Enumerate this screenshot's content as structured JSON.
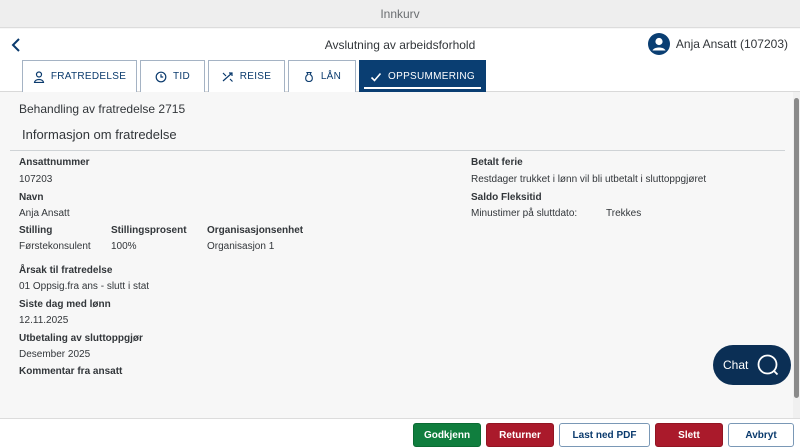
{
  "window": {
    "title": "Innkurv"
  },
  "header": {
    "title": "Avslutning av arbeidsforhold",
    "user": "Anja Ansatt (107203)"
  },
  "tabs": [
    {
      "label": "FRATREDELSE",
      "icon": "person-icon"
    },
    {
      "label": "TID",
      "icon": "clock-icon"
    },
    {
      "label": "REISE",
      "icon": "travel-icon"
    },
    {
      "label": "LÅN",
      "icon": "money-bag-icon"
    },
    {
      "label": "OPPSUMMERING",
      "icon": "check-icon",
      "active": true
    }
  ],
  "main": {
    "behandling": "Behandling av fratredelse 2715",
    "section_title": "Informasjon om fratredelse",
    "fields": {
      "ansattnummer_label": "Ansattnummer",
      "ansattnummer_value": "107203",
      "navn_label": "Navn",
      "navn_value": "Anja Ansatt",
      "stilling_label": "Stilling",
      "stilling_value": "Førstekonsulent",
      "stillingsprosent_label": "Stillingsprosent",
      "stillingsprosent_value": "100%",
      "orgenhet_label": "Organisasjonsenhet",
      "orgenhet_value": "Organisasjon 1",
      "arsak_label": "Årsak til fratredelse",
      "arsak_value": "01 Oppsig.fra ans - slutt i stat",
      "siste_dag_label": "Siste dag med lønn",
      "siste_dag_value": "12.11.2025",
      "utbetaling_label": "Utbetaling av sluttoppgjør",
      "utbetaling_value": "Desember 2025",
      "kommentar_label": "Kommentar fra ansatt",
      "betalt_ferie_label": "Betalt ferie",
      "betalt_ferie_value": "Restdager trukket i lønn vil bli utbetalt i sluttoppgjøret",
      "saldo_label": "Saldo Fleksitid",
      "minustimer_label": "Minustimer på sluttdato:",
      "minustimer_value": "Trekkes"
    }
  },
  "chat": {
    "label": "Chat"
  },
  "footer": {
    "godkjenn": "Godkjenn",
    "returner": "Returner",
    "last_ned_pdf": "Last ned PDF",
    "slett": "Slett",
    "avbryt": "Avbryt"
  },
  "colors": {
    "primary": "#0a3e72",
    "approve": "#107e3e",
    "danger": "#aa1a2b",
    "chat": "#0b2f55"
  }
}
